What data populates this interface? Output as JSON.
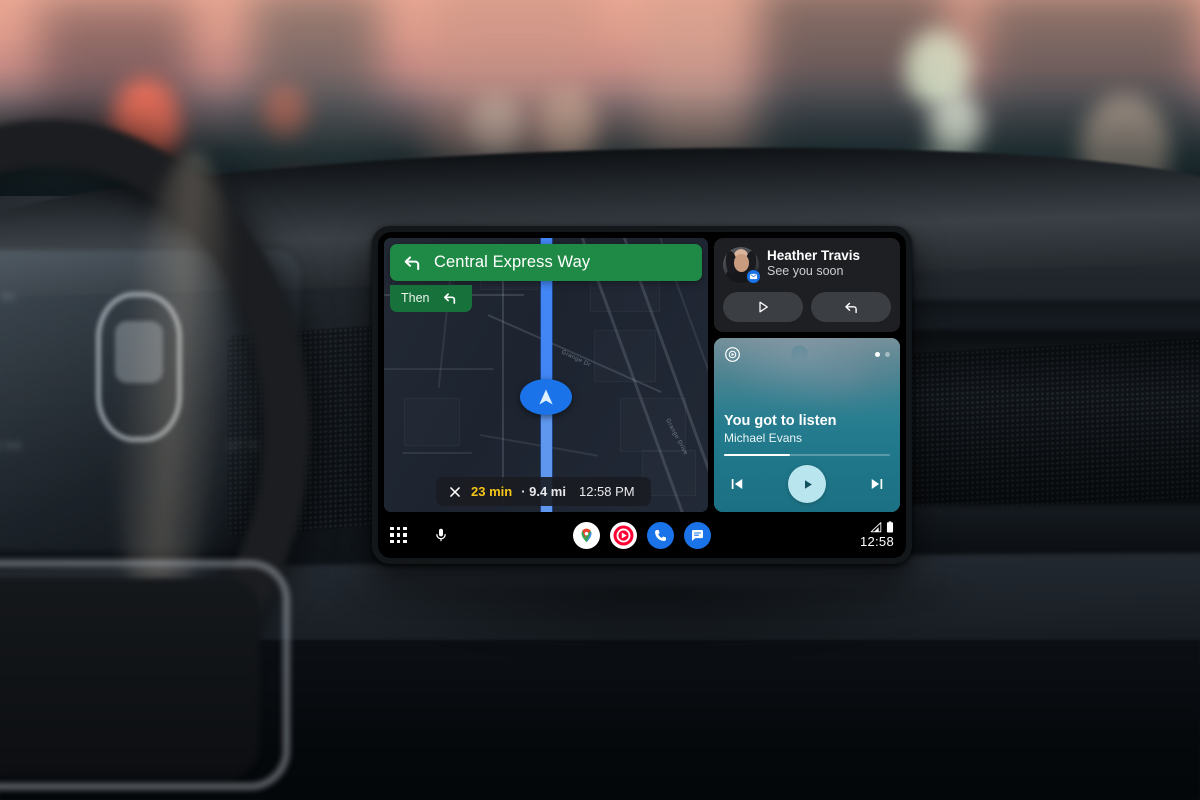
{
  "scene": {
    "description": "Android Auto head unit display mounted in a car dashboard at dusk",
    "ambient": {
      "sky_color": "#e8a794",
      "dash_color": "#20262c",
      "bokeh_colors": [
        "#f2705a",
        "#e8503c",
        "#ff2a22",
        "#d9e8d0",
        "#8fd0d8",
        "#f0c9a8"
      ]
    }
  },
  "head_unit": {
    "screen_background": "#000000"
  },
  "navigation": {
    "banner": {
      "maneuver_icon": "turn-left-arrow-icon",
      "street": "Central Express Way",
      "background_color": "#1e8a45"
    },
    "then": {
      "label": "Then",
      "maneuver_icon": "turn-left-arrow-icon",
      "background_color": "#17713a"
    },
    "trip": {
      "close_icon": "close-x-icon",
      "eta_duration": "23 min",
      "separator": "·",
      "distance": "9.4 mi",
      "arrival_time": "12:58 PM",
      "eta_color": "#f5c518"
    },
    "map": {
      "route_color": "#4285f4",
      "position_marker": "navigation-chevron-icon",
      "background_color": "#1f2632",
      "street_labels": [
        "Grange Dr",
        "Grange Drive"
      ]
    }
  },
  "notification": {
    "avatar": "contact-avatar",
    "app_badge": "messages-badge-icon",
    "sender": "Heather Travis",
    "preview": "See you soon",
    "actions": [
      {
        "name": "play-message-button",
        "icon": "play-triangle-icon"
      },
      {
        "name": "reply-button",
        "icon": "reply-arrow-icon"
      }
    ]
  },
  "media": {
    "source_icon": "youtube-music-icon",
    "title": "You got to listen",
    "artist": "Michael Evans",
    "progress_percent": 40,
    "page_dots": 2,
    "active_dot": 0,
    "accent_color": "#2b8b9b",
    "controls": [
      {
        "name": "previous-track-button",
        "icon": "skip-previous-icon"
      },
      {
        "name": "play-pause-button",
        "icon": "play-triangle-icon"
      },
      {
        "name": "next-track-button",
        "icon": "skip-next-icon"
      }
    ]
  },
  "taskbar": {
    "launcher_icon": "app-grid-icon",
    "assistant_icon": "microphone-icon",
    "apps": [
      {
        "name": "app-google-maps",
        "label": "Google Maps"
      },
      {
        "name": "app-youtube-music",
        "label": "YouTube Music"
      },
      {
        "name": "app-phone",
        "label": "Phone"
      },
      {
        "name": "app-messages",
        "label": "Messages"
      }
    ],
    "status": {
      "signal_icon": "cellular-signal-icon",
      "battery_icon": "battery-icon",
      "clock": "12:58"
    }
  }
}
